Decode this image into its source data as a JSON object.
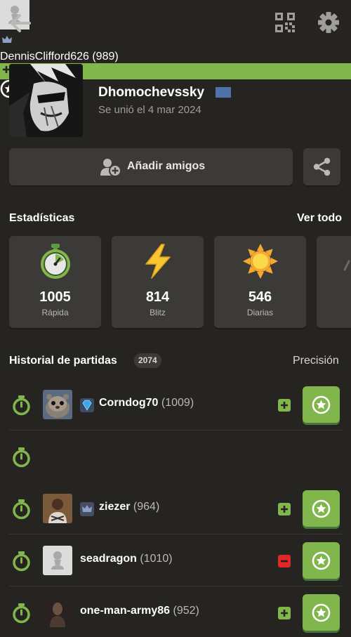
{
  "topbar": {
    "back_icon": "arrow-left-icon",
    "qr_icon": "qr-code-icon",
    "settings_icon": "gear-icon"
  },
  "profile": {
    "username": "Dhomochevsskу",
    "joined": "Se unió el 4 mar 2024",
    "flag_color": "#4e73a6"
  },
  "actions": {
    "add_friends_label": "Añadir amigos",
    "share_icon": "share-icon"
  },
  "stats": {
    "title": "Estadísticas",
    "see_all": "Ver todo",
    "cards": [
      {
        "value": "1005",
        "label": "Rápida",
        "icon": "stopwatch-icon"
      },
      {
        "value": "814",
        "label": "Blitz",
        "icon": "lightning-icon"
      },
      {
        "value": "546",
        "label": "Diarias",
        "icon": "sun-icon"
      }
    ]
  },
  "history": {
    "title": "Historial de partidas",
    "count": "2074",
    "accuracy_label": "Precisión",
    "games": [
      {
        "name": "Corndog70",
        "rating": "(1009)",
        "tier": "diamond",
        "result": "win"
      },
      {
        "name": "DennisClifford626",
        "rating": "(989)",
        "tier": "crown",
        "result": "win"
      },
      {
        "name": "ziezer",
        "rating": "(964)",
        "tier": "crown",
        "result": "win"
      },
      {
        "name": "seadragon",
        "rating": "(1010)",
        "tier": "",
        "result": "loss"
      },
      {
        "name": "one-man-army86",
        "rating": "(952)",
        "tier": "",
        "result": "win"
      }
    ]
  },
  "colors": {
    "background": "#262421",
    "card": "#3c3a37",
    "green": "#81b64c",
    "loss": "#e02828"
  }
}
